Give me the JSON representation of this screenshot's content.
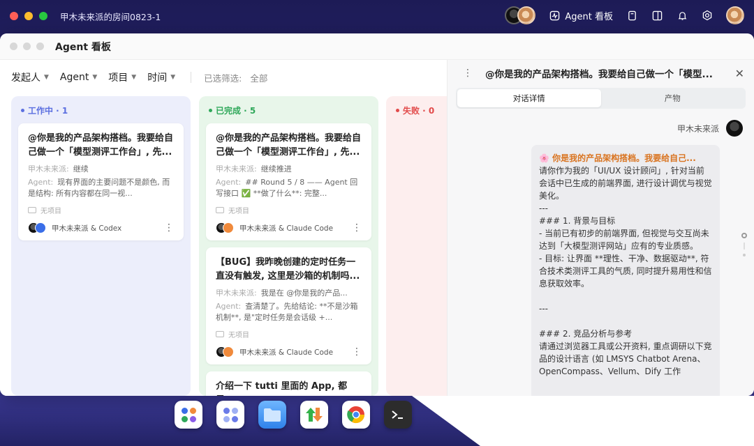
{
  "host": {
    "title": "甲木未来派的房间0823-1",
    "kanban_label": "Agent 看板"
  },
  "window": {
    "title": "Agent 看板"
  },
  "filters": {
    "items": [
      "发起人",
      "Agent",
      "项目",
      "时间"
    ],
    "selected_label": "已选筛选:",
    "selected_value": "全部"
  },
  "columns": {
    "running": {
      "label": "工作中 · 1",
      "color": "#5b6fe0"
    },
    "done": {
      "label": "已完成 · 5",
      "color": "#2fa85a"
    },
    "failed": {
      "label": "失败 · 0",
      "color": "#e24a4a"
    }
  },
  "cards": {
    "running_1": {
      "title": "@你是我的产品架构搭档。我要给自己做一个「模型测评工作台」, 先...",
      "user_label": "甲木未来派:",
      "user_text": "继续",
      "agent_label": "Agent:",
      "agent_text": "现有界面的主要问题不是颜色, 而是结构: 所有内容都在同一视...",
      "project": "无项目",
      "owner": "甲木未来派 & Codex"
    },
    "done_1": {
      "title": "@你是我的产品架构搭档。我要给自己做一个「模型测评工作台」, 先...",
      "user_label": "甲木未来派:",
      "user_text": "继续推进",
      "agent_label": "Agent:",
      "agent_text": "## Round 5 / 8 —— Agent 回写接口 ✅ **做了什么**: 完整...",
      "project": "无项目",
      "owner": "甲木未来派 & Claude Code"
    },
    "done_2": {
      "title": "【BUG】我昨晚创建的定时任务一直没有触发, 这里是沙箱的机制吗...",
      "user_label": "甲木未来派:",
      "user_text": "我是在 @你是我的产品...",
      "agent_label": "Agent:",
      "agent_text": "查清楚了。先给结论: **不是沙箱机制**, 是\"定时任务是会话级 +...",
      "project": "无项目",
      "owner": "甲木未来派 & Claude Code"
    },
    "done_3": {
      "title": "介绍一下 tutti 里面的 App, 都是..."
    }
  },
  "panel": {
    "title": "@你是我的产品架构搭档。我要给自己做一个「模型...",
    "tab_chat": "对话详情",
    "tab_artifacts": "产物",
    "sender": "甲木未来派",
    "message_first": "🌸 你是我的产品架构搭档。我要给自己...",
    "message_body": "请你作为我的「UI/UX 设计顾问」, 针对当前会话中已生成的前端界面, 进行设计调优与视觉美化。\n---\n### 1. 背景与目标\n- 当前已有初步的前端界面, 但视觉与交互尚未达到「大模型测评网站」应有的专业质感。\n- 目标: 让界面 **理性、干净、数据驱动**, 符合技术类测评工具的气质, 同时提升易用性和信息获取效率。\n\n---\n\n### 2. 竞品分析与参考\n请通过浏览器工具或公开资料, 重点调研以下竞品的设计语言 (如 LMSYS Chatbot Arena、OpenCompass、Vellum、Dify 工作"
  },
  "colors": {
    "accent": "#5b6fe0",
    "success": "#2fa85a",
    "danger": "#e24a4a",
    "message_highlight": "#d9731f"
  }
}
